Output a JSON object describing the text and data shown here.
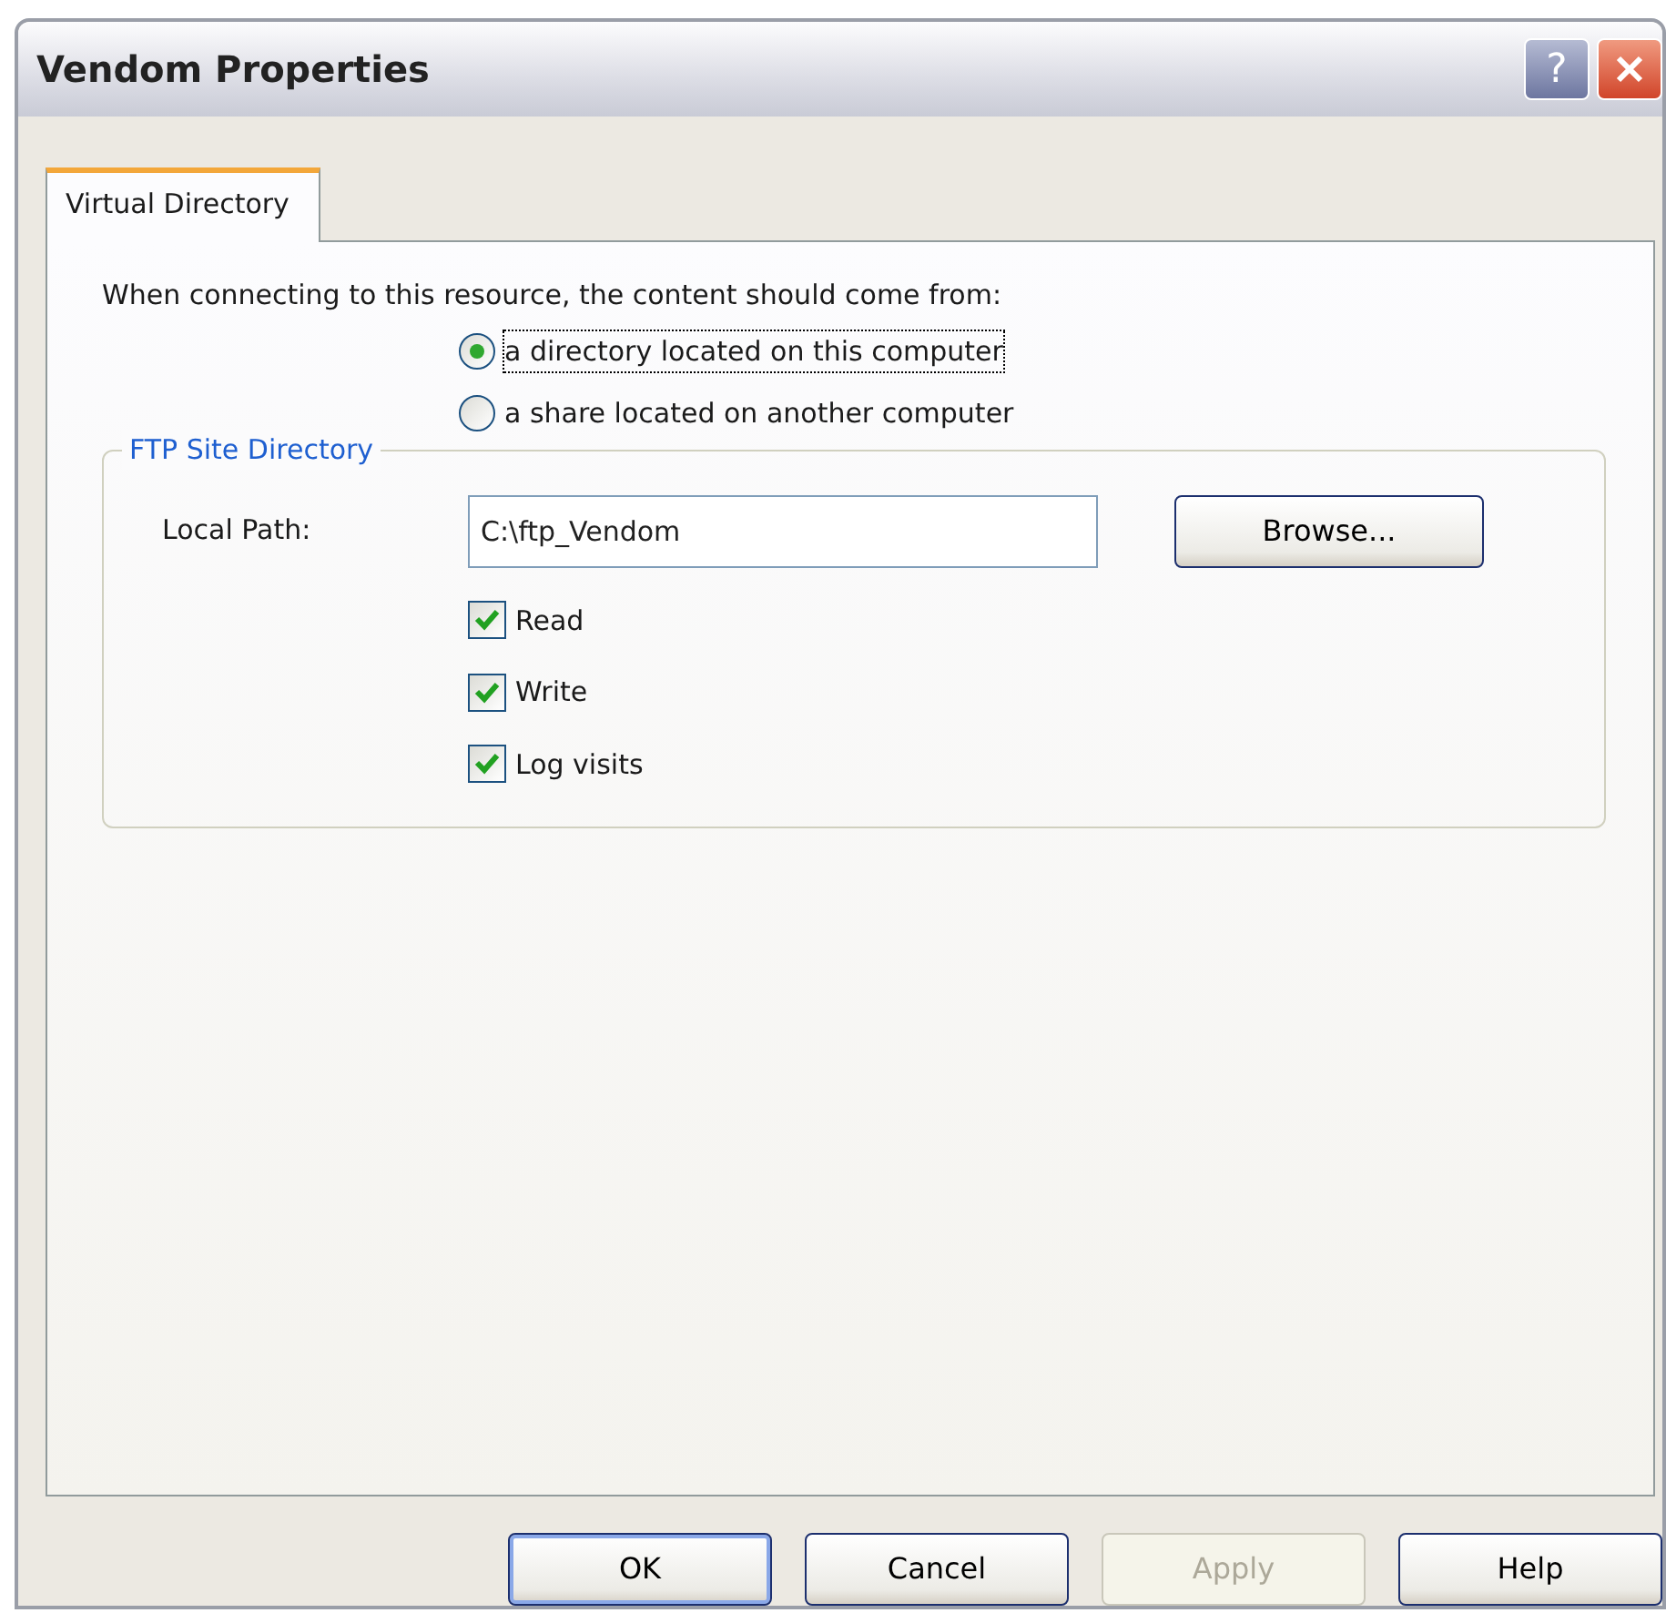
{
  "window": {
    "title": "Vendom Properties",
    "buttons": [
      {
        "kind": "help",
        "label": "?"
      },
      {
        "kind": "close"
      }
    ]
  },
  "tabs": [
    {
      "label": "Virtual Directory",
      "selected": true
    }
  ],
  "prompt": "When connecting to this resource, the content should come from:",
  "source_options": [
    {
      "label": "a directory located on this computer",
      "selected": true,
      "focused": true
    },
    {
      "label": "a share located on another computer",
      "selected": false,
      "focused": false
    }
  ],
  "group": {
    "title": "FTP Site Directory",
    "path_label": "Local Path:",
    "path_value": "C:\\ftp_Vendom",
    "browse_button": "Browse...",
    "permissions": [
      {
        "label": "Read",
        "checked": true
      },
      {
        "label": "Write",
        "checked": true
      },
      {
        "label": "Log visits",
        "checked": true
      }
    ]
  },
  "buttons": [
    {
      "label": "OK",
      "disabled": false,
      "default": true
    },
    {
      "label": "Cancel",
      "disabled": false,
      "default": false
    },
    {
      "label": "Apply",
      "disabled": true,
      "default": false
    },
    {
      "label": "Help",
      "disabled": false,
      "default": false
    }
  ]
}
